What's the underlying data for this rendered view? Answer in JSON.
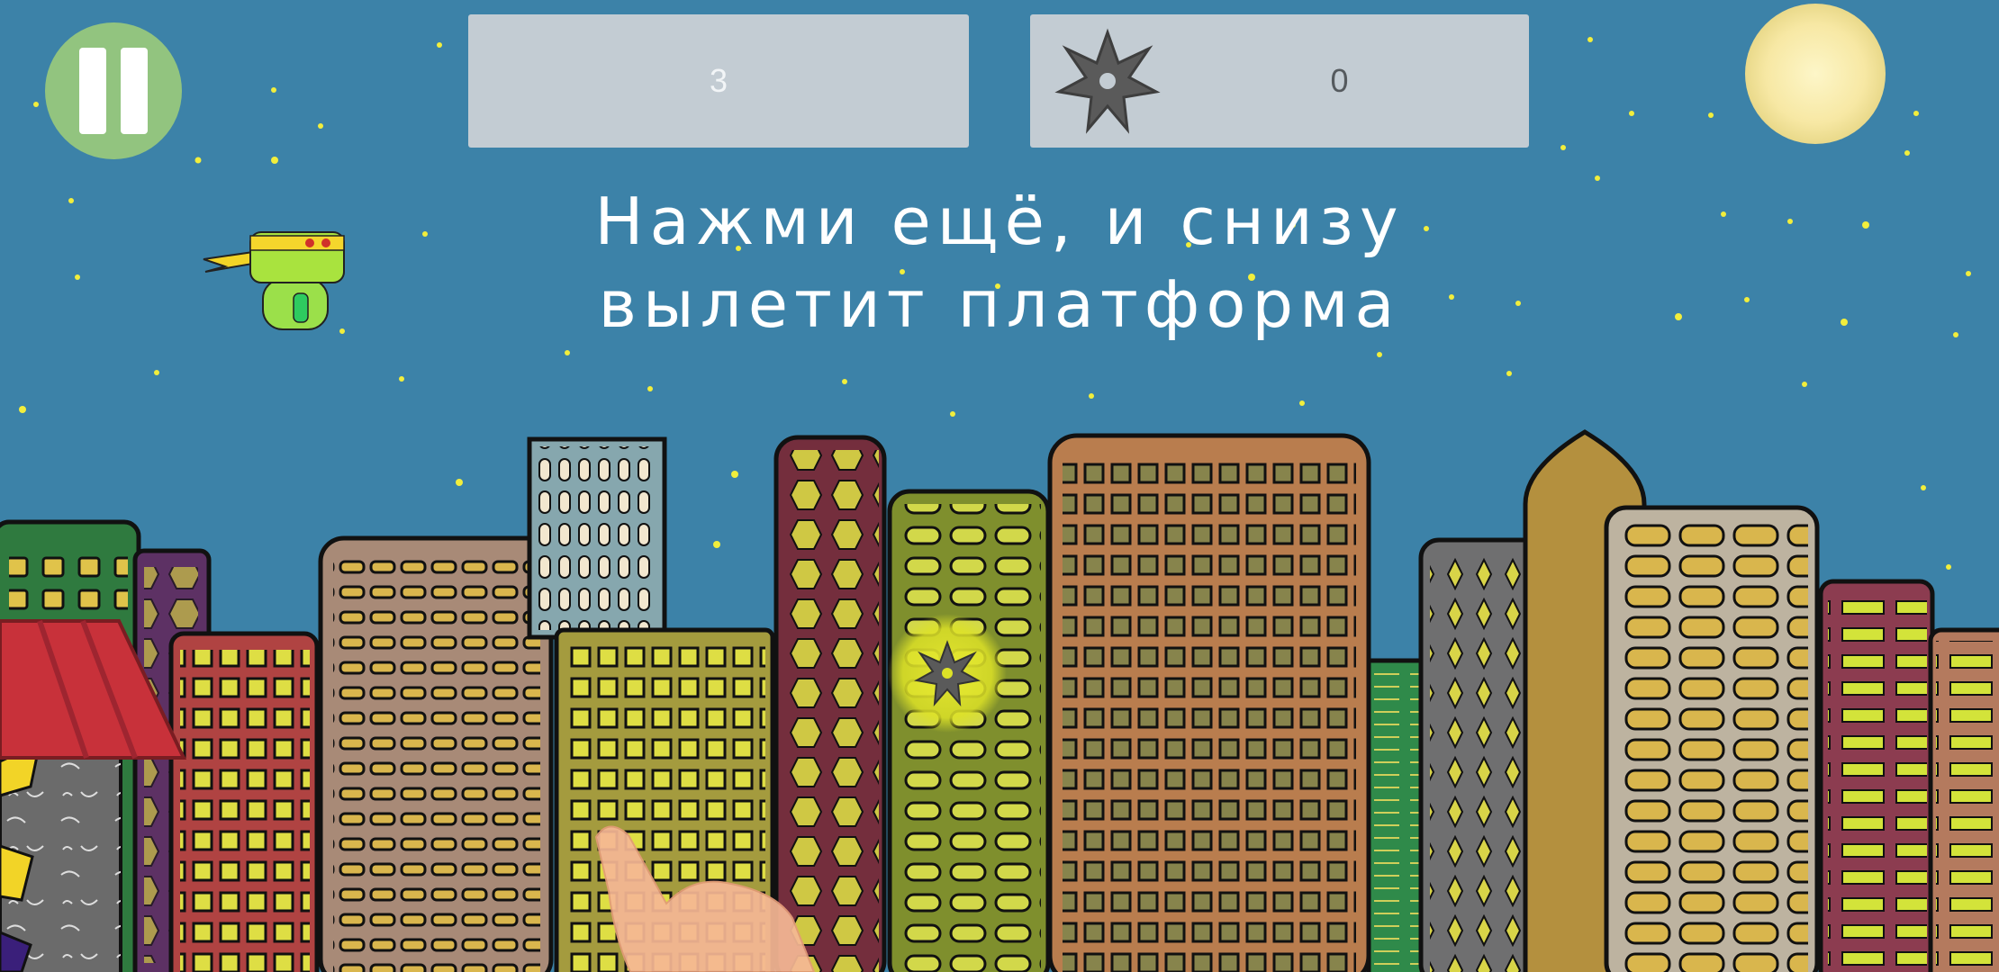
{
  "hud": {
    "score": "3",
    "shuriken_count": "0",
    "shuriken_icon": "shuriken-icon",
    "pause_icon": "pause-icon"
  },
  "hint": {
    "line1": "Нажми ещё, и снизу",
    "line2": "вылетит платформа"
  },
  "colors": {
    "sky": "#3c82a8",
    "star": "#f2ee3c",
    "moon": "#fbf0b4",
    "pause_button": "#92c47f",
    "hud_panel": "#c3ccd3",
    "player_body": "#9be04a",
    "player_bandana": "#f5d62c",
    "shuriken": "#5a5a5a"
  }
}
